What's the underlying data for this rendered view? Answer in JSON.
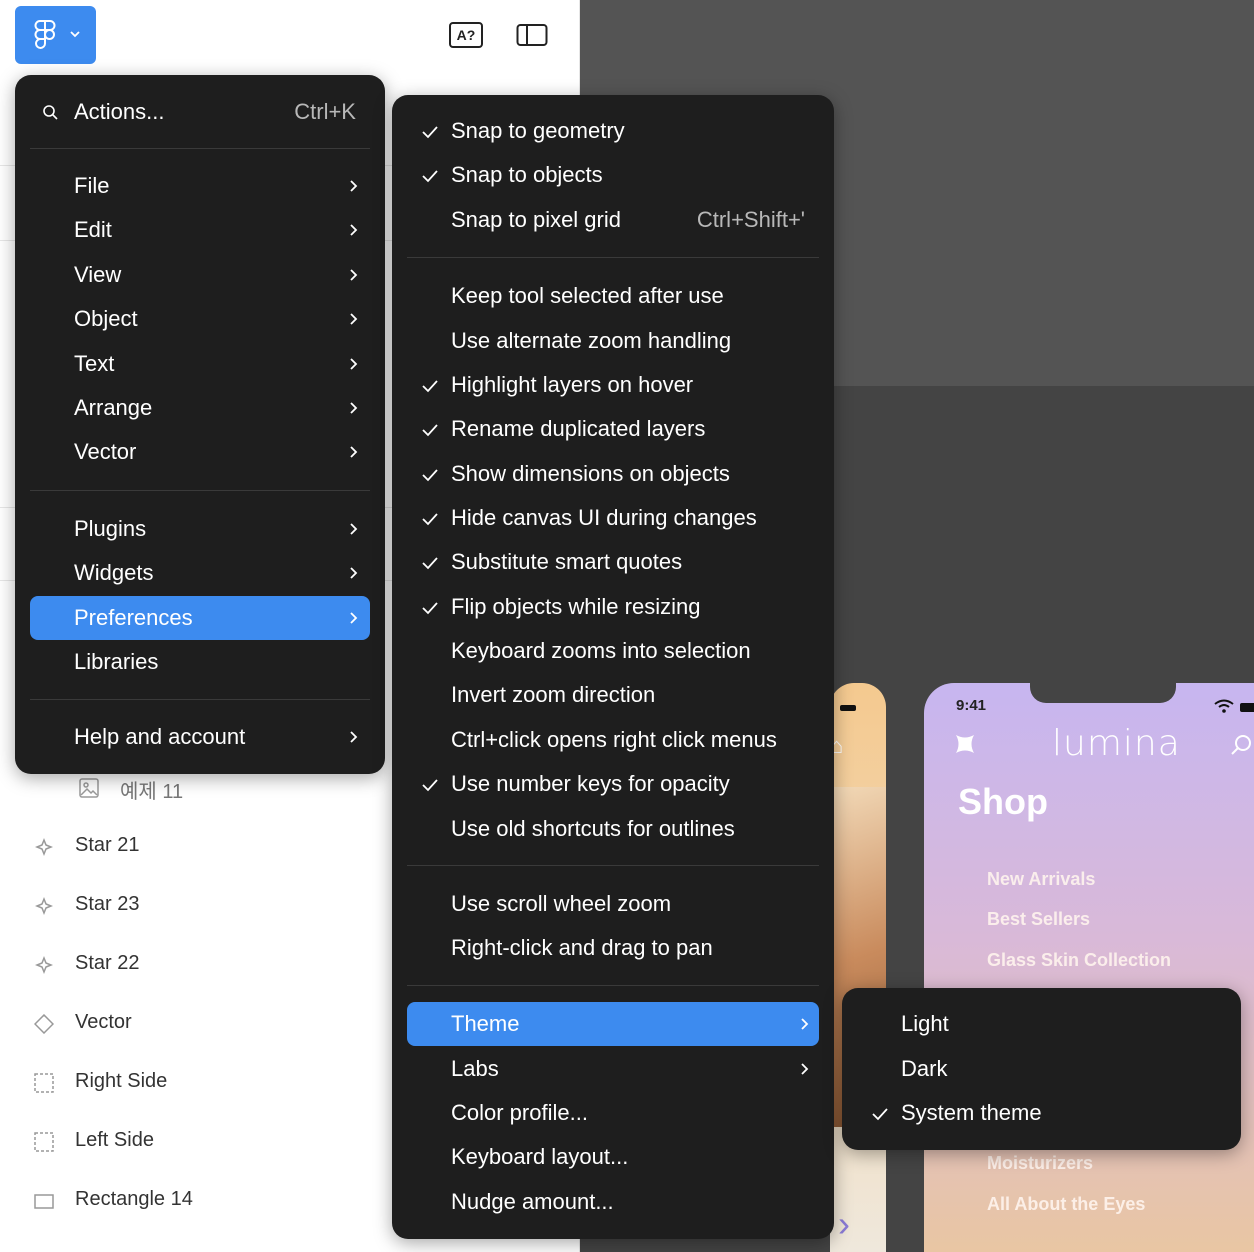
{
  "colors": {
    "accent": "#3d8bef",
    "menu_bg": "#1e1e1e",
    "canvas_bg": "#444444"
  },
  "main_menu": {
    "search_label": "Actions...",
    "search_shortcut": "Ctrl+K",
    "items": [
      {
        "label": "File",
        "has_submenu": true
      },
      {
        "label": "Edit",
        "has_submenu": true
      },
      {
        "label": "View",
        "has_submenu": true
      },
      {
        "label": "Object",
        "has_submenu": true
      },
      {
        "label": "Text",
        "has_submenu": true
      },
      {
        "label": "Arrange",
        "has_submenu": true
      },
      {
        "label": "Vector",
        "has_submenu": true
      },
      {
        "label": "Plugins",
        "has_submenu": true
      },
      {
        "label": "Widgets",
        "has_submenu": true
      },
      {
        "label": "Preferences",
        "has_submenu": true,
        "selected": true
      },
      {
        "label": "Libraries",
        "has_submenu": false
      },
      {
        "label": "Help and account",
        "has_submenu": true
      }
    ]
  },
  "prefs_menu": {
    "items": [
      {
        "label": "Snap to geometry",
        "checked": true
      },
      {
        "label": "Snap to objects",
        "checked": true
      },
      {
        "label": "Snap to pixel grid",
        "checked": false,
        "shortcut": "Ctrl+Shift+'"
      },
      {
        "label": "Keep tool selected after use",
        "checked": false
      },
      {
        "label": "Use alternate zoom handling",
        "checked": false
      },
      {
        "label": "Highlight layers on hover",
        "checked": true
      },
      {
        "label": "Rename duplicated layers",
        "checked": true
      },
      {
        "label": "Show dimensions on objects",
        "checked": true
      },
      {
        "label": "Hide canvas UI during changes",
        "checked": true
      },
      {
        "label": "Substitute smart quotes",
        "checked": true
      },
      {
        "label": "Flip objects while resizing",
        "checked": true
      },
      {
        "label": "Keyboard zooms into selection",
        "checked": false
      },
      {
        "label": "Invert zoom direction",
        "checked": false
      },
      {
        "label": "Ctrl+click opens right click menus",
        "checked": false
      },
      {
        "label": "Use number keys for opacity",
        "checked": true
      },
      {
        "label": "Use old shortcuts for outlines",
        "checked": false
      },
      {
        "label": "Use scroll wheel zoom",
        "checked": false
      },
      {
        "label": "Right-click and drag to pan",
        "checked": false
      },
      {
        "label": "Theme",
        "has_submenu": true,
        "selected": true
      },
      {
        "label": "Labs",
        "has_submenu": true
      },
      {
        "label": "Color profile...",
        "has_submenu": false
      },
      {
        "label": "Keyboard layout...",
        "has_submenu": false
      },
      {
        "label": "Nudge amount...",
        "has_submenu": false
      }
    ]
  },
  "theme_menu": {
    "items": [
      {
        "label": "Light",
        "checked": false
      },
      {
        "label": "Dark",
        "checked": false
      },
      {
        "label": "System theme",
        "checked": true
      }
    ]
  },
  "layers": [
    {
      "name": "예제 11",
      "icon": "image-icon"
    },
    {
      "name": "Star 21",
      "icon": "star-icon"
    },
    {
      "name": "Star 23",
      "icon": "star-icon"
    },
    {
      "name": "Star 22",
      "icon": "star-icon"
    },
    {
      "name": "Vector",
      "icon": "vector-icon"
    },
    {
      "name": "Right Side",
      "icon": "frame-dashed-icon"
    },
    {
      "name": "Left Side",
      "icon": "frame-dashed-icon"
    },
    {
      "name": "Rectangle 14",
      "icon": "rectangle-icon"
    }
  ],
  "toolbar": {
    "text_tool_icon_label": "A?"
  },
  "preview": {
    "time": "9:41",
    "brand": "lumina",
    "title": "Shop",
    "categories": [
      "New Arrivals",
      "Best Sellers",
      "Glass Skin Collection",
      "Moisturizers",
      "All About the Eyes"
    ]
  }
}
